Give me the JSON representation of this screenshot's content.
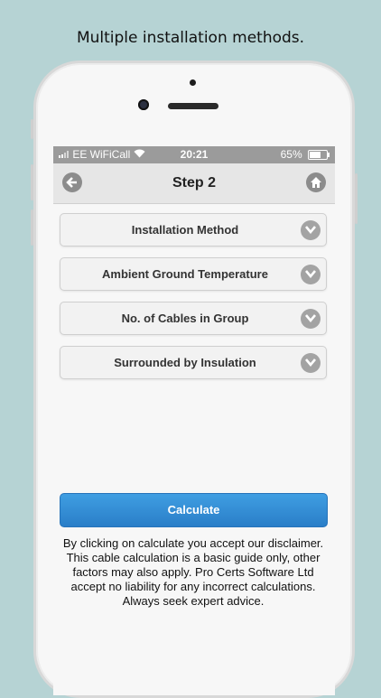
{
  "caption": "Multiple installation methods.",
  "status_bar": {
    "carrier": "EE WiFiCall",
    "time": "20:21",
    "battery": "65%",
    "battery_level": 0.65
  },
  "header": {
    "title": "Step 2",
    "back_icon": "arrow-left-icon",
    "home_icon": "home-icon"
  },
  "fields": [
    {
      "label": "Installation Method"
    },
    {
      "label": "Ambient Ground Temperature"
    },
    {
      "label": "No. of Cables in Group"
    },
    {
      "label": "Surrounded by Insulation"
    }
  ],
  "calculate_label": "Calculate",
  "disclaimer": "By clicking on calculate you accept our disclaimer. This cable calculation is a basic guide only, other factors may also apply. Pro Certs Software Ltd accept no liability for any incorrect calculations. Always seek expert advice.",
  "colors": {
    "accent": "#2a7ec8",
    "header_bg": "#e6e6e6",
    "status_bg": "#9b9b9b",
    "background": "#b6d3d4"
  }
}
